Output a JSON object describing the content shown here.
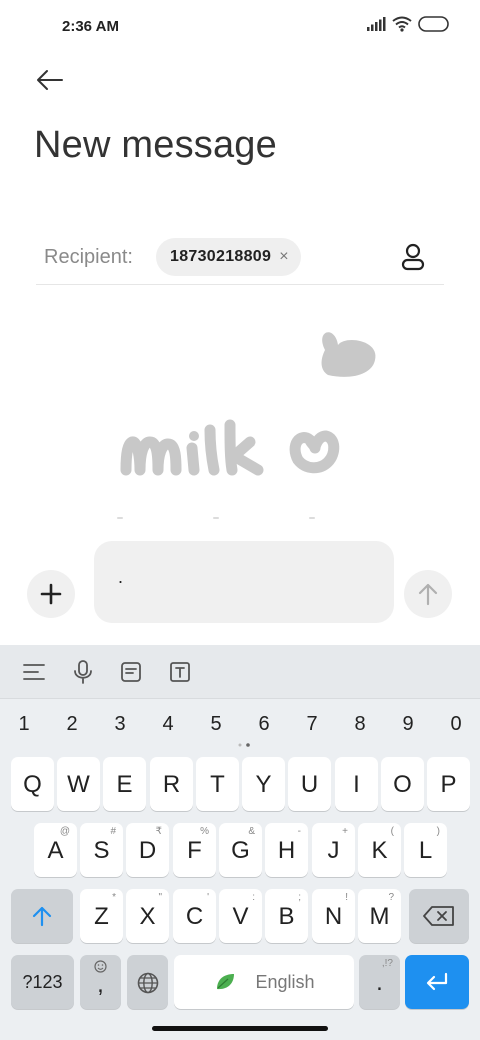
{
  "status_bar": {
    "time": "2:36 AM"
  },
  "header": {
    "title": "New message"
  },
  "recipient": {
    "label": "Recipient:",
    "chip": "18730218809",
    "chip_close": "×"
  },
  "composer": {
    "text": "."
  },
  "keyboard": {
    "numbers": [
      "1",
      "2",
      "3",
      "4",
      "5",
      "6",
      "7",
      "8",
      "9",
      "0"
    ],
    "row1": [
      "Q",
      "W",
      "E",
      "R",
      "T",
      "Y",
      "U",
      "I",
      "O",
      "P"
    ],
    "row2": [
      "A",
      "S",
      "D",
      "F",
      "G",
      "H",
      "J",
      "K",
      "L"
    ],
    "row2_sup": [
      "@",
      "#",
      "₹",
      "%",
      "&",
      "-",
      "+",
      "(",
      ")"
    ],
    "row3": [
      "Z",
      "X",
      "C",
      "V",
      "B",
      "N",
      "M"
    ],
    "row3_sup": [
      "*",
      "\"",
      "'",
      ":",
      ";",
      "!",
      "?"
    ],
    "numeric_label": "?123",
    "comma": ",",
    "space_label": "English",
    "period": ".",
    "period_sup": ",!?"
  },
  "colors": {
    "accent": "#1e90f0",
    "chip_bg": "#efefef",
    "keyboard_bg": "#eceff2"
  }
}
